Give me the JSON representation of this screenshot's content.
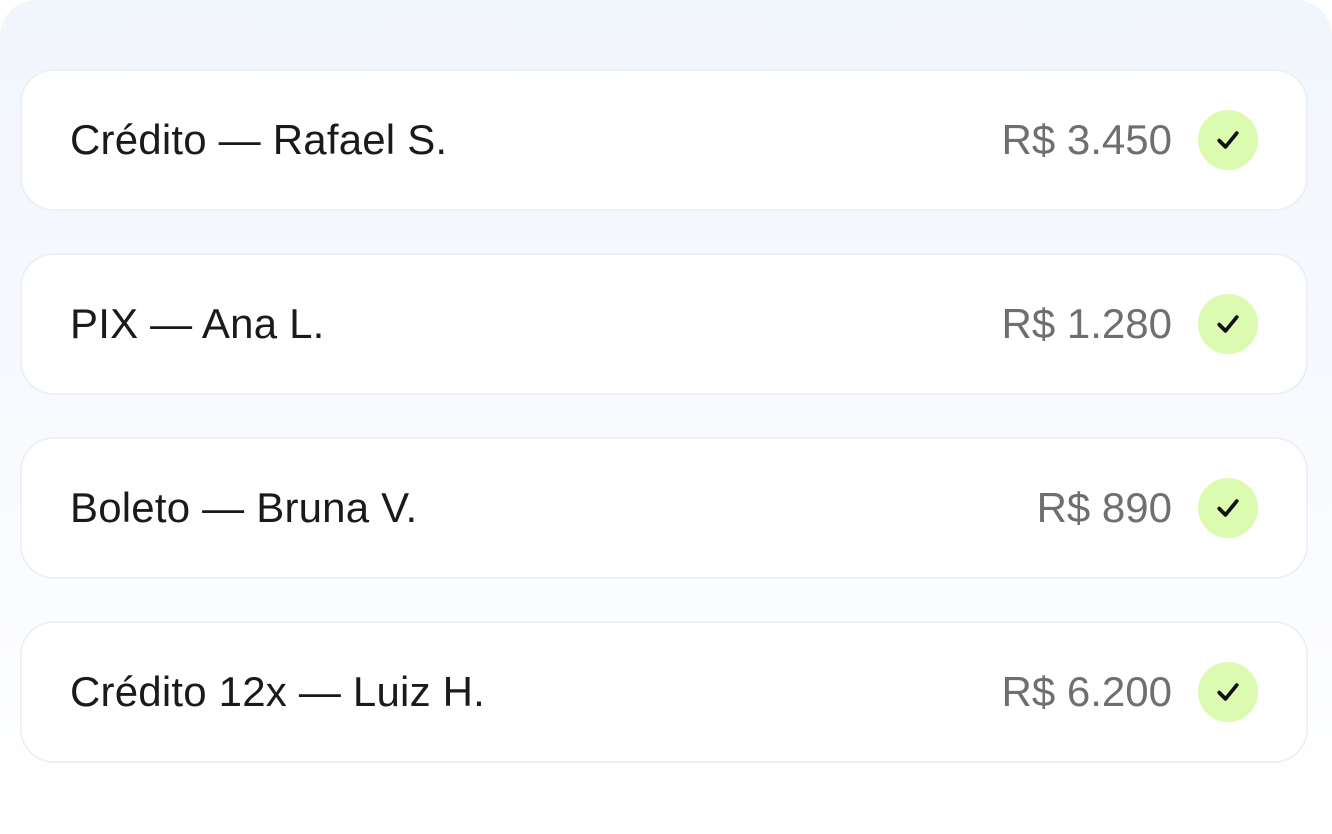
{
  "accent_color": "#dafbb0",
  "transactions": [
    {
      "label": "Crédito — Rafael S.",
      "amount": "R$ 3.450",
      "status_icon": "check-icon"
    },
    {
      "label": "PIX — Ana L.",
      "amount": "R$ 1.280",
      "status_icon": "check-icon"
    },
    {
      "label": "Boleto — Bruna V.",
      "amount": "R$ 890",
      "status_icon": "check-icon"
    },
    {
      "label": "Crédito 12x — Luiz H.",
      "amount": "R$ 6.200",
      "status_icon": "check-icon"
    }
  ]
}
